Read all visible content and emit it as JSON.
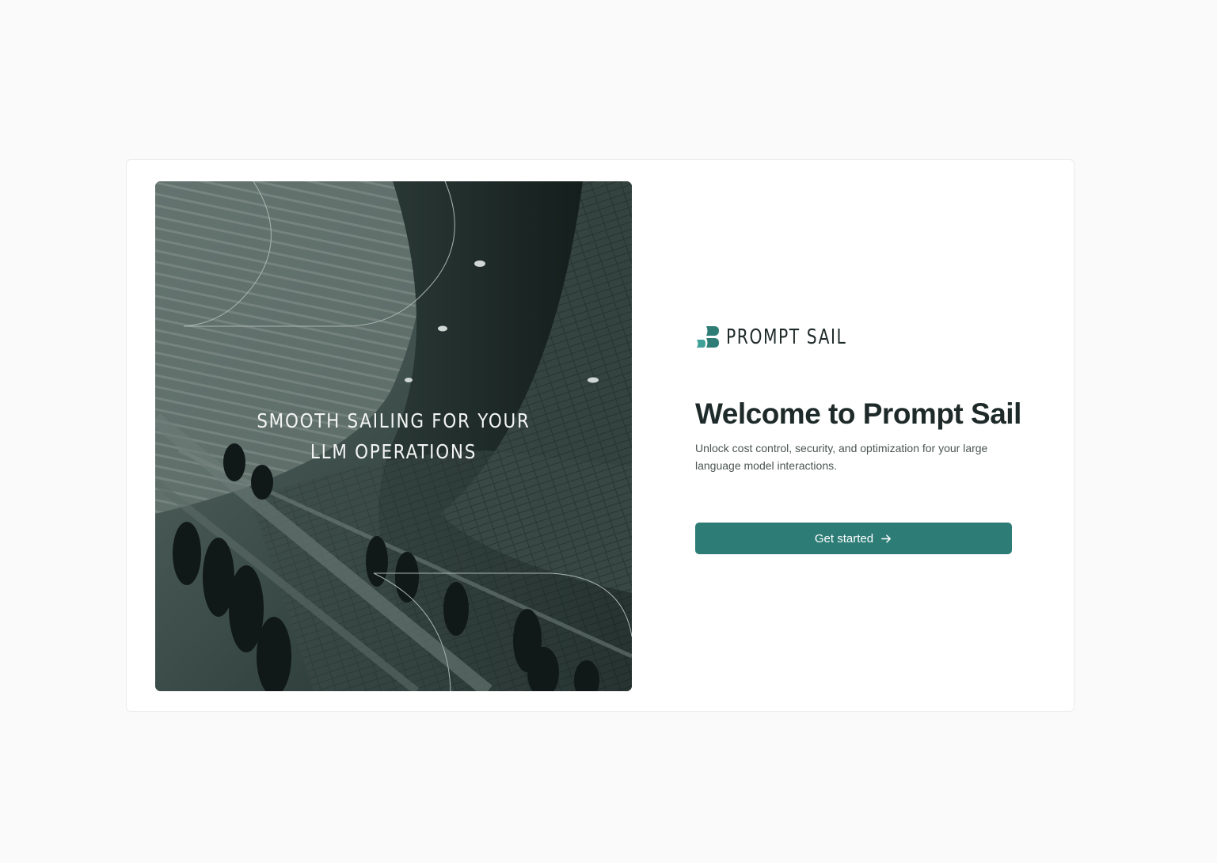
{
  "hero": {
    "tagline_line1": "SMOOTH SAILING FOR YOUR",
    "tagline_line2": "LLM OPERATIONS",
    "image": "escalator-photo"
  },
  "brand": {
    "logo_icon": "prompt-sail-logo-icon",
    "name": "PROMPT SAIL",
    "accent_color": "#2d7d76"
  },
  "welcome": {
    "title": "Welcome to Prompt Sail",
    "subtitle": "Unlock cost control, security, and optimization for your large language model interactions."
  },
  "cta": {
    "label": "Get started",
    "icon": "arrow-right-icon"
  }
}
